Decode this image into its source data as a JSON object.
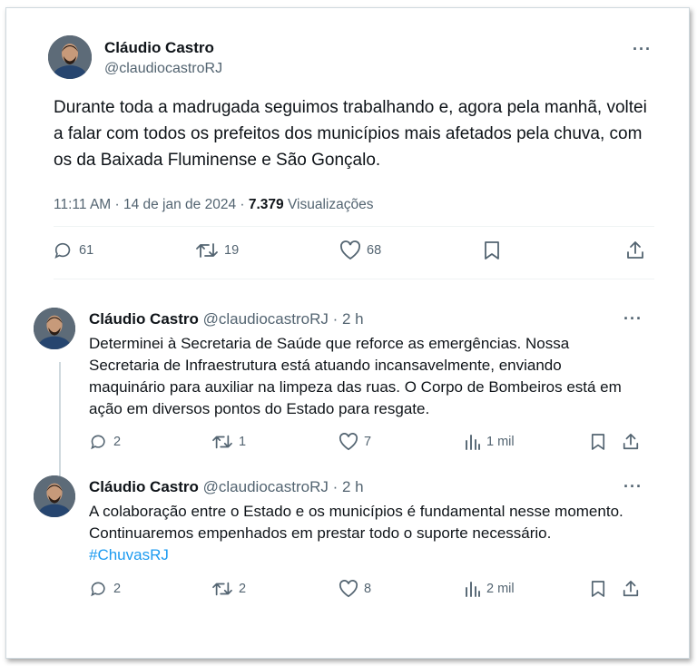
{
  "main_tweet": {
    "name": "Cláudio Castro",
    "handle": "@claudiocastroRJ",
    "text": "Durante toda a madrugada seguimos trabalhando e, agora pela manhã, voltei a falar com todos os prefeitos dos municípios mais afetados pela chuva, com os da Baixada Fluminense e São Gonçalo.",
    "time": "11:11 AM · 14 de jan de 2024 · ",
    "views_count": "7.379",
    "views_label": " Visualizações",
    "replies": "61",
    "retweets": "19",
    "likes": "68"
  },
  "replies": [
    {
      "name": "Cláudio Castro",
      "handle": "@claudiocastroRJ · 2 h",
      "text": "Determinei à Secretaria de Saúde que reforce as emergências. Nossa Secretaria de Infraestrutura está atuando incansavelmente, enviando maquinário para auxiliar na limpeza das ruas. O Corpo de Bombeiros está em ação em diversos pontos do Estado para resgate.",
      "replies": "2",
      "retweets": "1",
      "likes": "7",
      "views": "1 mil"
    },
    {
      "name": "Cláudio Castro",
      "handle": "@claudiocastroRJ · 2 h",
      "text": "A colaboração entre o Estado e os municípios é fundamental nesse momento. Continuaremos empenhados em prestar todo o suporte necessário. ",
      "hashtag": "#ChuvasRJ",
      "replies": "2",
      "retweets": "2",
      "likes": "8",
      "views": "2 mil"
    }
  ],
  "icons": {
    "more": "more-horizontal-icon",
    "reply": "reply-bubble-icon",
    "retweet": "retweet-icon",
    "like": "heart-icon",
    "bookmark": "bookmark-icon",
    "share": "share-icon",
    "views": "views-bar-chart-icon"
  },
  "colors": {
    "text": "#0f1419",
    "muted": "#536471",
    "link": "#1d9bf0",
    "border": "#cfd9de"
  }
}
